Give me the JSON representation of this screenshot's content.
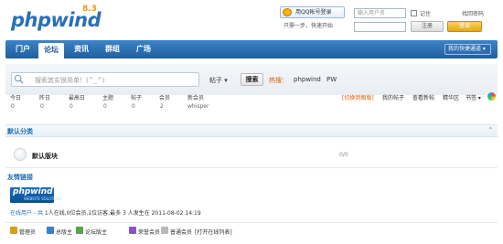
{
  "header": {
    "logo_text": "phpwind",
    "logo_version": "8.3",
    "qq_button": "用QQ帐号登录",
    "qq_note": "只需一步，快速开始",
    "username_placeholder": "输入用户名",
    "remember_label": "记住",
    "forgot_label": "找回密码",
    "register_label": "注册",
    "login_label": "登录"
  },
  "nav": {
    "items": [
      "门户",
      "论坛",
      "资讯",
      "群组",
      "广场"
    ],
    "active_index": 1,
    "right_label": "我的快捷通道 ▾"
  },
  "search": {
    "placeholder": "搜索其实很简单！(^_^)",
    "type_label": "帖子 ▾",
    "button": "搜索",
    "hot_label": "热搜：",
    "hot_terms": [
      "phpwind",
      "PW"
    ]
  },
  "stats": {
    "labels": [
      "今日",
      "昨日",
      "最高日",
      "主题",
      "帖子",
      "会员",
      "新会员"
    ],
    "values": [
      "0",
      "0",
      "0",
      "0",
      "0",
      "2",
      "whisper"
    ]
  },
  "toolbar": {
    "switch_label": "[切换到图版]",
    "links": [
      "我的帖子",
      "查看新帖",
      "精华区",
      "书签 ▾"
    ]
  },
  "category": {
    "title": "默认分类",
    "arrow": "⌃"
  },
  "forum": {
    "name": "默认版块",
    "count": "0/0"
  },
  "friend_links": {
    "title": "友情链接",
    "logo_text": "phpwind",
    "logo_sub": "WEBSITE SOLUTIONS"
  },
  "online": {
    "prefix": "在线用户 - 共",
    "text": "1人在线,0位会员,1位访客,最多 3 人发生在 2011-08-02 14:19"
  },
  "legend": {
    "items": [
      "管理员",
      "总版主",
      "论坛版主",
      "荣誉会员",
      "普通会员"
    ],
    "colors": [
      "#d4a017",
      "#3b7fd1",
      "#59a34a",
      "#8b54c6",
      "#b9b9b9"
    ],
    "toggle": "[打开在线列表]"
  },
  "colors": {
    "nav_blue": "#2a6fb8",
    "accent_orange": "#e25b00",
    "link_blue": "#1f6db5"
  }
}
